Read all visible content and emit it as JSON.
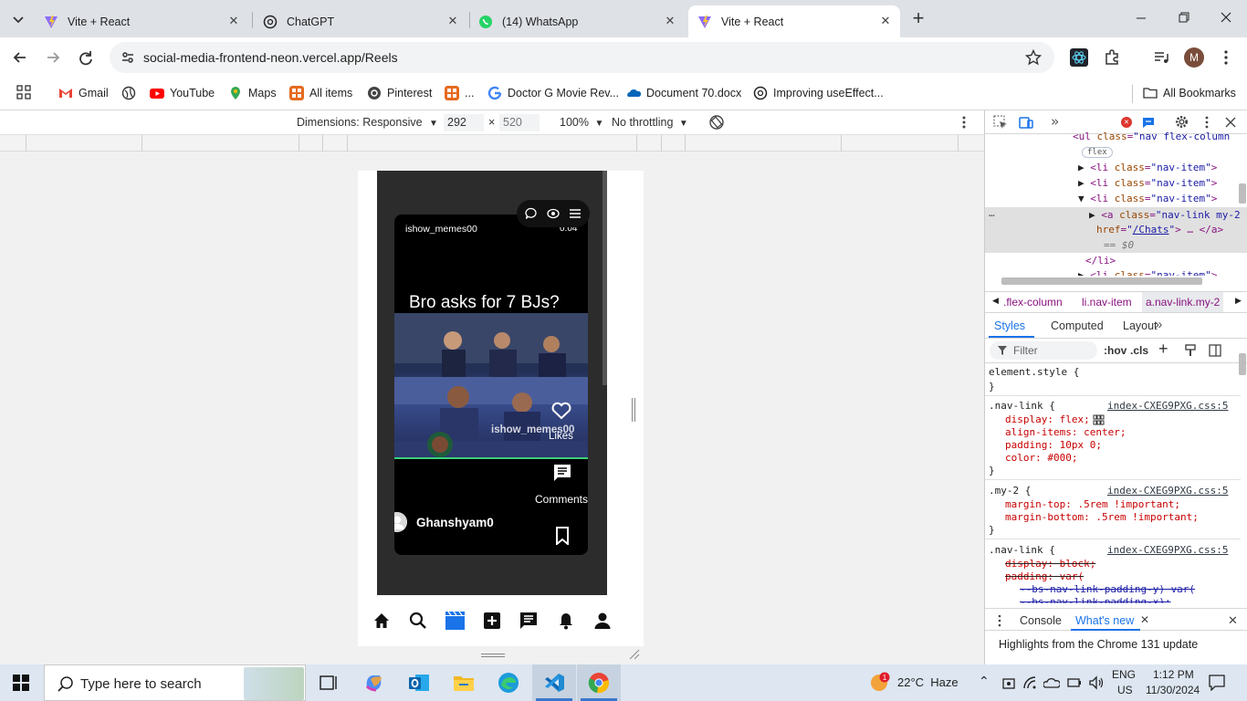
{
  "browser": {
    "tabs": [
      {
        "title": "Vite + React",
        "active": false
      },
      {
        "title": "ChatGPT",
        "active": false
      },
      {
        "title": "(14) WhatsApp",
        "active": false
      },
      {
        "title": "Vite + React",
        "active": true
      }
    ],
    "url": "social-media-frontend-neon.vercel.app/Reels",
    "profile_initial": "M"
  },
  "bookmarks": {
    "items": [
      "Gmail",
      "YouTube",
      "Maps",
      "All items",
      "Pinterest",
      "...",
      "Doctor G Movie Rev...",
      "Document 70.docx",
      "Improving useEffect..."
    ],
    "all_bookmarks": "All Bookmarks"
  },
  "device_toolbar": {
    "dimensions_label": "Dimensions: Responsive",
    "width": "292",
    "times": "×",
    "height": "520",
    "zoom": "100%",
    "throttling": "No throttling"
  },
  "reel": {
    "username": "ishow_memes00",
    "time": "0:04",
    "caption": "Bro asks for 7 BJs?",
    "watermark": "ishow_memes00",
    "likes_label": "Likes",
    "comments_label": "Comments",
    "author": "Ghanshyam0"
  },
  "devtools": {
    "elements": [
      {
        "indent": 0,
        "text": "<ul class=\"nav flex-column"
      },
      {
        "indent": 1,
        "badge": "flex"
      },
      {
        "indent": 1,
        "text": "<li class=\"nav-item\">"
      },
      {
        "indent": 1,
        "text": "<li class=\"nav-item\">"
      },
      {
        "indent": 1,
        "text": "<li class=\"nav-item\">"
      },
      {
        "indent": 2,
        "text": "<a class=\"nav-link my-2"
      },
      {
        "indent": 2,
        "text": "href=\"/Chats\"> </a>"
      },
      {
        "indent": 2,
        "text": "== $0"
      },
      {
        "indent": 1,
        "text": "</li>"
      },
      {
        "indent": 1,
        "text": "<li class=\"nav-item\">"
      }
    ],
    "breadcrumbs": [
      ".flex-column",
      "li.nav-item",
      "a.nav-link.my-2"
    ],
    "style_tabs": [
      "Styles",
      "Computed",
      "Layout"
    ],
    "filter_placeholder": "Filter",
    "hov": ":hov",
    "cls": ".cls",
    "rules": {
      "element_style": "element.style {",
      "close": "}",
      "nav_link_1": {
        "selector": ".nav-link {",
        "source": "index-CXEG9PXG.css:5",
        "decls": [
          "display: flex;",
          "align-items: center;",
          "padding: 10px 0;",
          "color: #000;"
        ]
      },
      "my_2": {
        "selector": ".my-2 {",
        "source": "index-CXEG9PXG.css:5",
        "decls": [
          "margin-top: .5rem !important;",
          "margin-bottom: .5rem !important;"
        ]
      },
      "nav_link_2": {
        "selector": ".nav-link {",
        "source": "index-CXEG9PXG.css:5",
        "decls": [
          "display: block;",
          "padding: var(",
          "--bs-nav-link-padding-y) var(",
          "--bs-nav-link-padding-x);"
        ]
      }
    },
    "drawer_tabs": [
      "Console",
      "What's new"
    ],
    "whats_new": "Highlights from the Chrome 131 update"
  },
  "taskbar": {
    "search_placeholder": "Type here to search",
    "weather": "22°C  Haze",
    "lang": "ENG",
    "region": "US",
    "time": "1:12 PM",
    "date": "11/30/2024"
  },
  "colors": {
    "accent": "#1a73e8",
    "devtools_blue": "#1a73e8",
    "reel_bg": "#000000"
  }
}
